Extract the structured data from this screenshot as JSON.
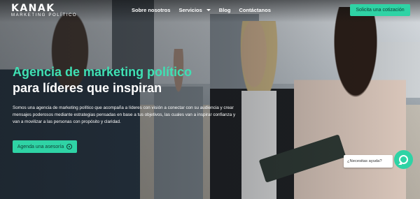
{
  "brand": {
    "name": "KANAK",
    "tagline": "MARKETING POLÍTICO"
  },
  "nav": {
    "items": [
      {
        "label": "Sobre nosotros"
      },
      {
        "label": "Servicios",
        "has_dropdown": true
      },
      {
        "label": "Blog"
      },
      {
        "label": "Contáctanos"
      }
    ],
    "cta_label": "Solicita una cotización"
  },
  "hero": {
    "title_line1": "Agencia de marketing político",
    "title_line2": "para líderes que inspiran",
    "description": "Somos una agencia de marketing político que acompaña a líderes con visión a conectar con su audiencia y crear mensajes poderosos mediante estrategias pensadas en base a tus objetivos, las cuales van a inspirar confianza y van a movilizar a las personas con propósito y claridad.",
    "cta_label": "Agenda una asesoría"
  },
  "chat": {
    "prompt": "¿Necesitas ayuda?"
  },
  "colors": {
    "accent": "#2fd3a5",
    "accent_text": "#3fe0b3"
  }
}
